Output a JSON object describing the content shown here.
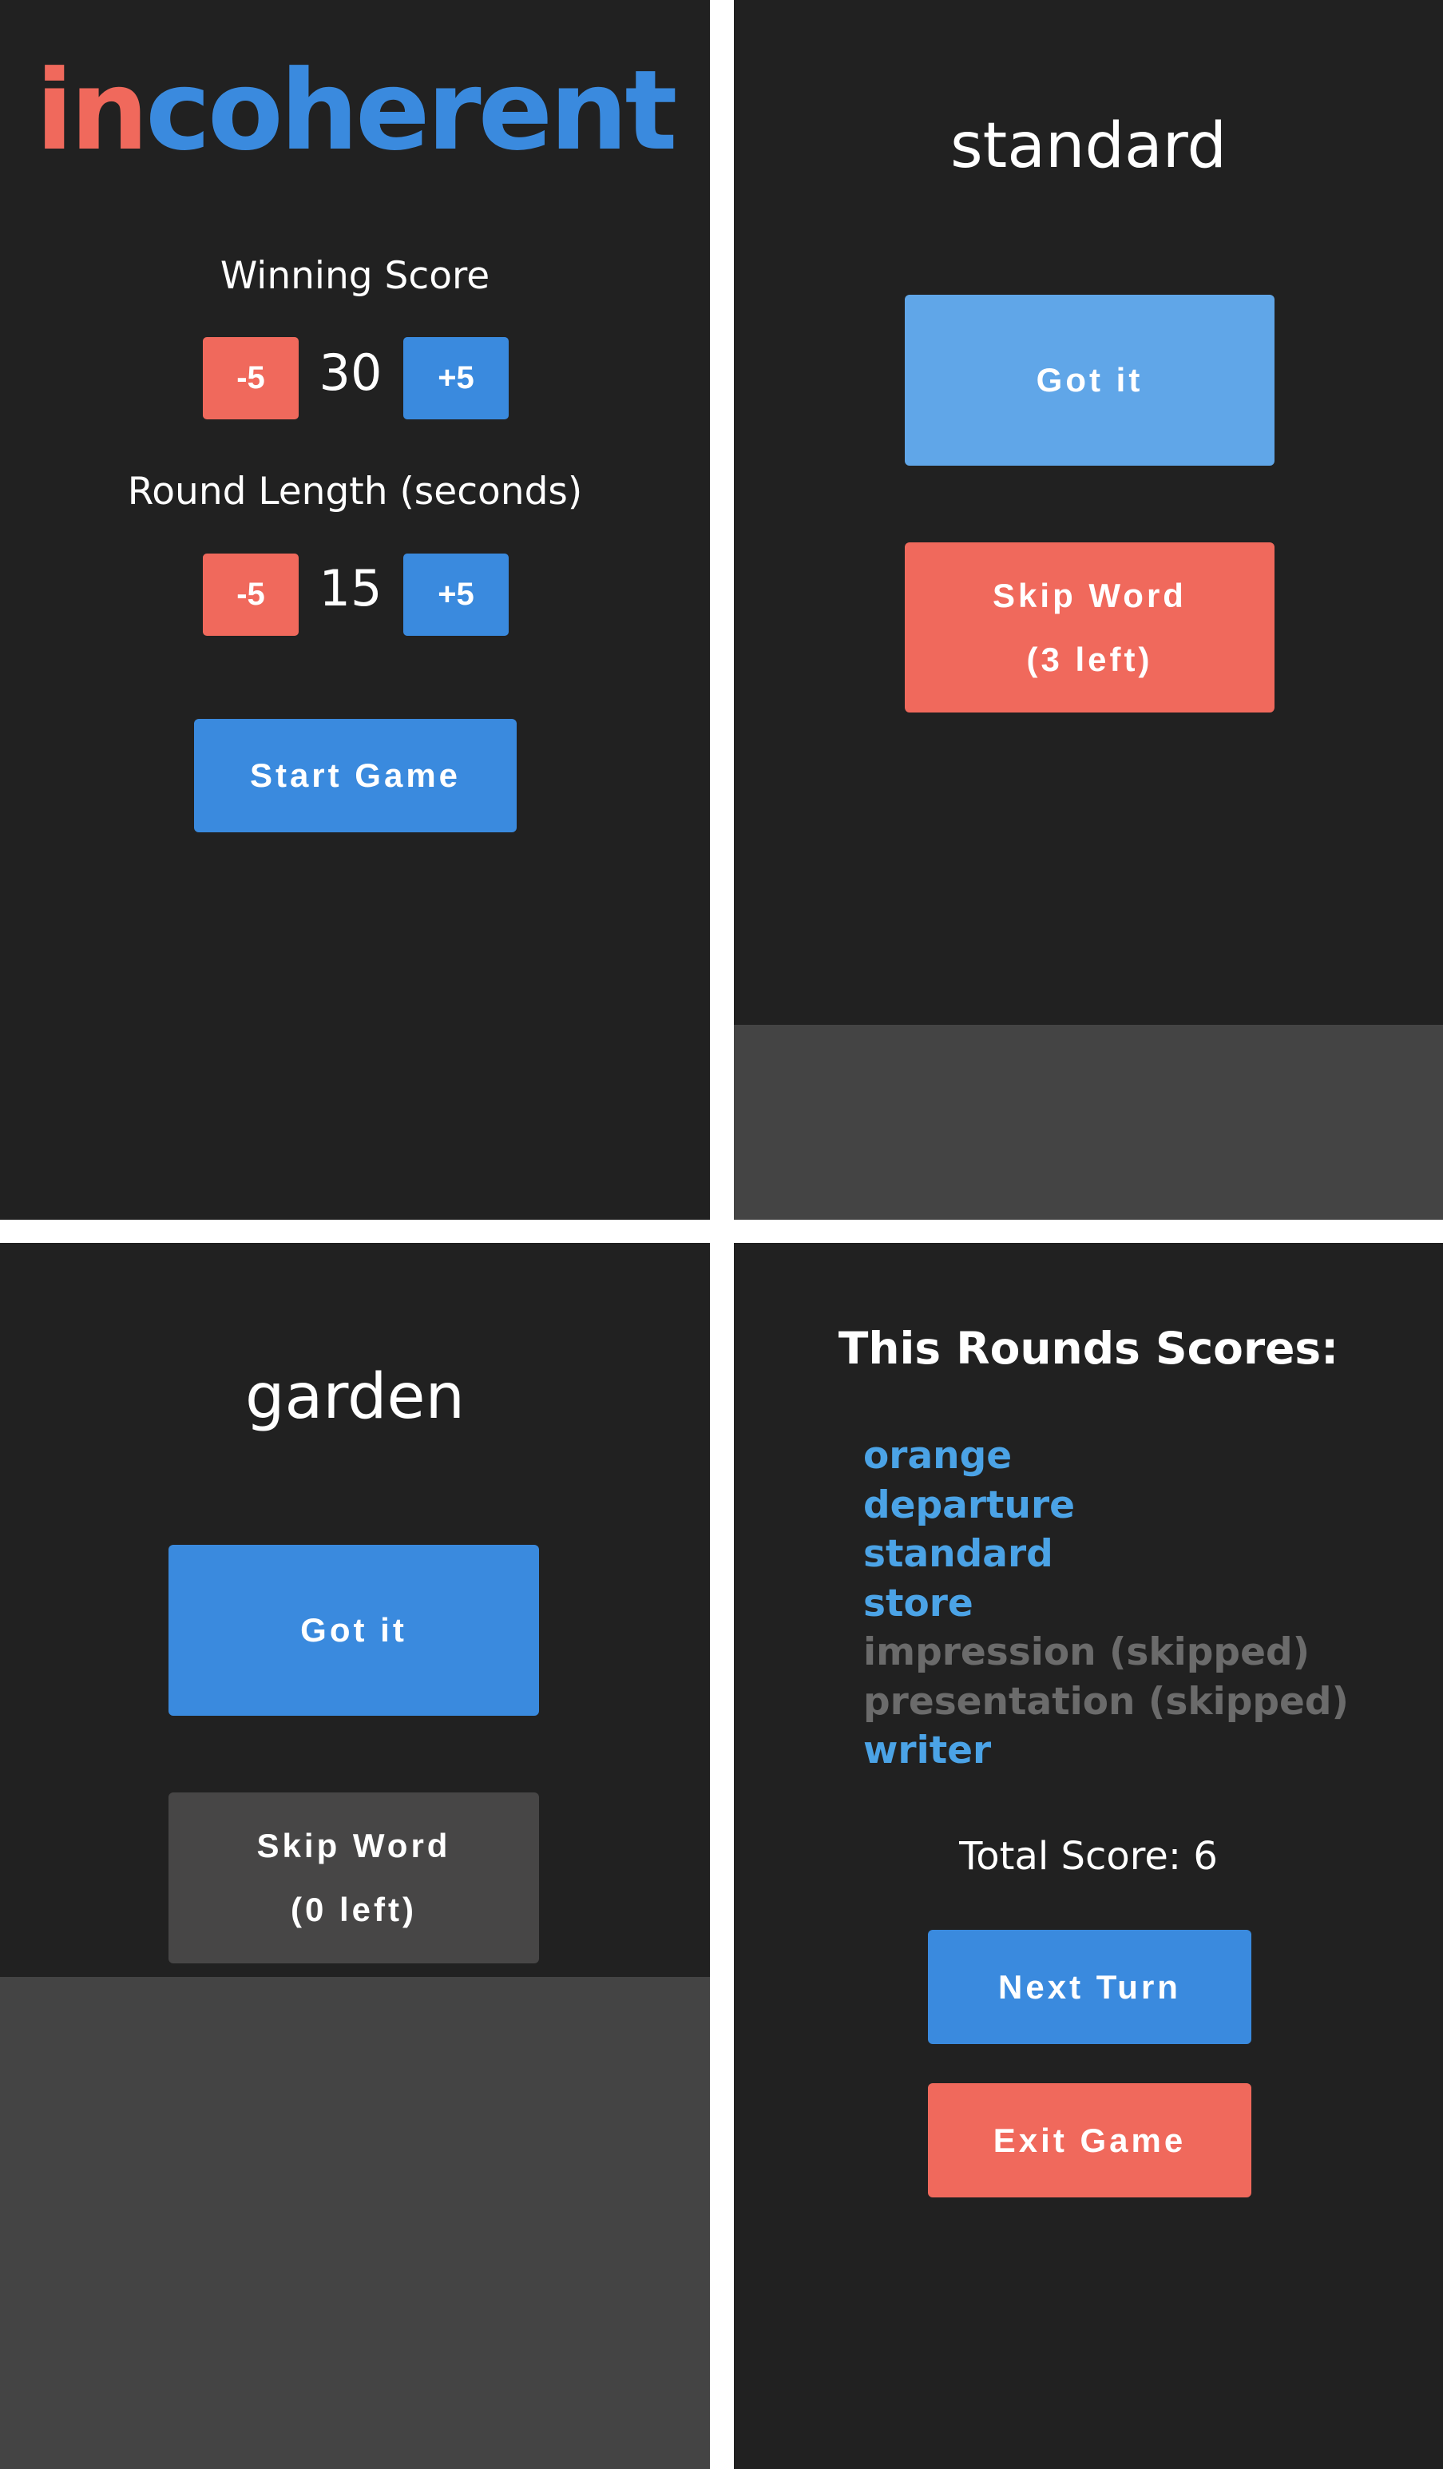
{
  "setup": {
    "logo_in": "in",
    "logo_rest": "coherent",
    "winning_score_label": "Winning Score",
    "winning_score_value": "30",
    "round_length_label": "Round Length (seconds)",
    "round_length_value": "15",
    "minus_label": "-5",
    "plus_label": "+5",
    "start_label": "Start Game"
  },
  "round_active": {
    "word": "standard",
    "got_it_label": "Got it",
    "skip_label": "Skip Word",
    "skip_left": "(3 left)"
  },
  "round_no_skips": {
    "word": "garden",
    "got_it_label": "Got it",
    "skip_label": "Skip Word",
    "skip_left": "(0 left)"
  },
  "scores": {
    "title": "This Rounds Scores:",
    "words": [
      {
        "text": "orange",
        "skipped": false
      },
      {
        "text": "departure",
        "skipped": false
      },
      {
        "text": "standard",
        "skipped": false
      },
      {
        "text": "store",
        "skipped": false
      },
      {
        "text": "impression (skipped)",
        "skipped": true
      },
      {
        "text": "presentation (skipped)",
        "skipped": true
      },
      {
        "text": "writer",
        "skipped": false
      }
    ],
    "total": "Total Score: 6",
    "next_label": "Next Turn",
    "exit_label": "Exit Game"
  },
  "colors": {
    "background": "#212121",
    "blue": "#3a8ade",
    "light_blue": "#60a6e8",
    "red": "#f0695c",
    "disabled_gray": "#474646",
    "scored_word": "#4ba3e6",
    "skipped_word": "#6b6b6b"
  }
}
